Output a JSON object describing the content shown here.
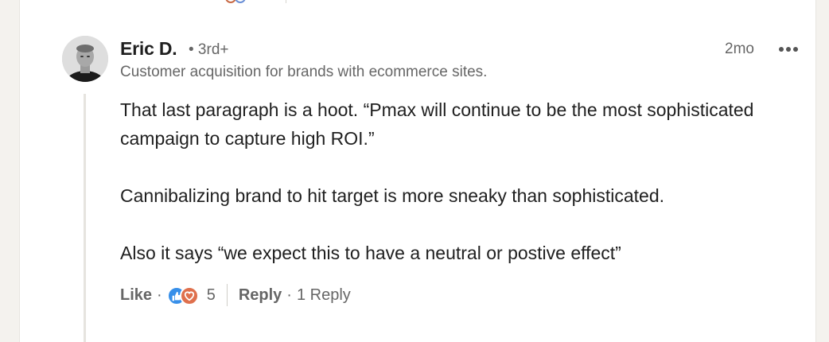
{
  "comment": {
    "author_name": "Eric D.",
    "degree": "• 3rd+",
    "headline": "Customer acquisition for brands with ecommerce sites.",
    "time_ago": "2mo",
    "paragraphs": [
      "That last paragraph is a hoot. “Pmax will continue to be the most sophisticated campaign to capture high ROI.”",
      "Cannibalizing brand to hit target is more sneaky than sophisticated.",
      "Also it says “we expect this to have a neutral or postive effect”"
    ]
  },
  "actions": {
    "like_label": "Like",
    "separator": "·",
    "reaction_count": "5",
    "reply_label": "Reply",
    "replies_count_label": "1 Reply",
    "reaction_icons": [
      "like-icon",
      "love-icon"
    ]
  },
  "colors": {
    "like": "#378fe9",
    "love": "#df704d",
    "text_primary": "#1f1f1f",
    "text_secondary": "#666666"
  }
}
